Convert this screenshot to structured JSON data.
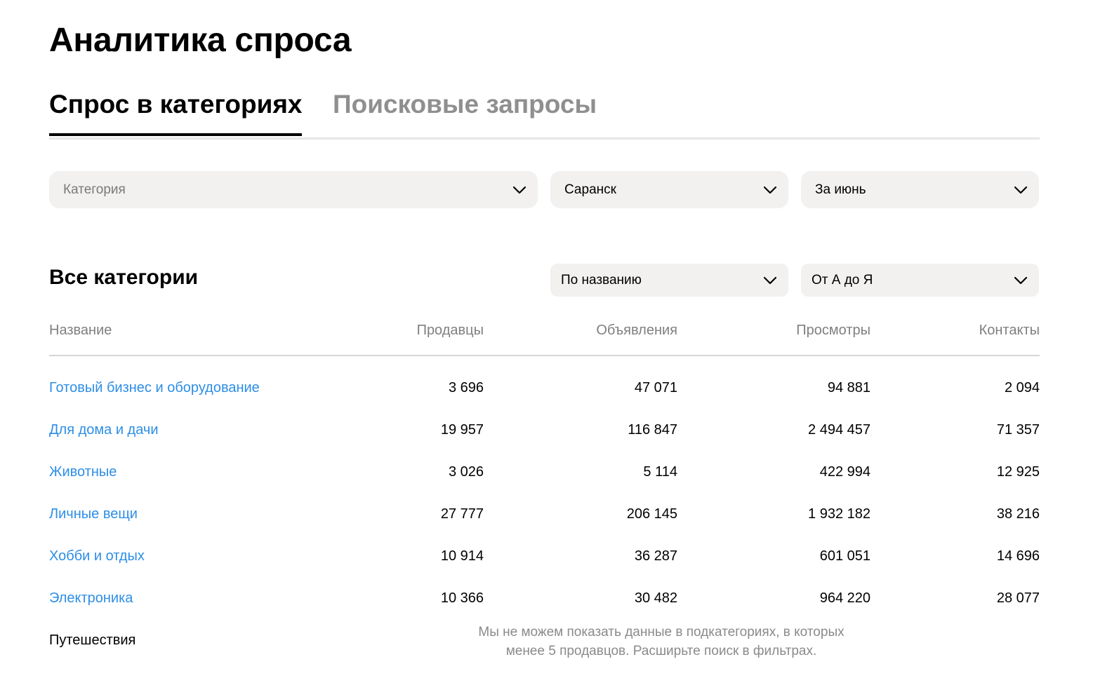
{
  "page": {
    "title": "Аналитика спроса"
  },
  "tabs": [
    {
      "label": "Спрос в категориях",
      "active": true
    },
    {
      "label": "Поисковые запросы",
      "active": false
    }
  ],
  "filters": {
    "category": {
      "placeholder": "Категория",
      "value": ""
    },
    "city": {
      "value": "Саранск"
    },
    "period": {
      "value": "За июнь"
    }
  },
  "section": {
    "title": "Все категории",
    "sort_field": "По названию",
    "sort_order": "От А до Я"
  },
  "table": {
    "columns": [
      "Название",
      "Продавцы",
      "Объявления",
      "Просмотры",
      "Контакты"
    ],
    "rows": [
      {
        "name": "Готовый бизнес и оборудование",
        "sellers": "3 696",
        "ads": "47 071",
        "views": "94 881",
        "contacts": "2 094"
      },
      {
        "name": "Для дома и дачи",
        "sellers": "19 957",
        "ads": "116 847",
        "views": "2 494 457",
        "contacts": "71 357"
      },
      {
        "name": "Животные",
        "sellers": "3 026",
        "ads": "5 114",
        "views": "422 994",
        "contacts": "12 925"
      },
      {
        "name": "Личные вещи",
        "sellers": "27 777",
        "ads": "206 145",
        "views": "1 932 182",
        "contacts": "38 216"
      },
      {
        "name": "Хобби и отдых",
        "sellers": "10 914",
        "ads": "36 287",
        "views": "601 051",
        "contacts": "14 696"
      },
      {
        "name": "Электроника",
        "sellers": "10 366",
        "ads": "30 482",
        "views": "964 220",
        "contacts": "28 077"
      }
    ],
    "restricted_row": {
      "name": "Путешествия",
      "note_line1": "Мы не можем показать данные в подкатегориях, в которых",
      "note_line2": "менее 5 продавцов. Расширьте поиск в фильтрах."
    }
  },
  "colors": {
    "link": "#2d8ee6",
    "muted": "#8f8f8f",
    "field_bg": "#f2f1f0"
  },
  "icons": {
    "dropdown": "chevron-down-icon"
  }
}
